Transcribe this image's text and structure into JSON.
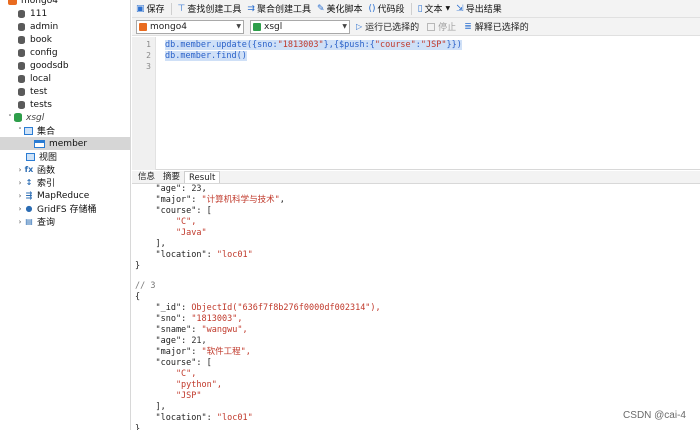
{
  "sidebar": {
    "connection": "mongo4",
    "databases": [
      "111",
      "admin",
      "book",
      "config",
      "goodsdb",
      "local",
      "test",
      "tests"
    ],
    "current_db": "xsgl",
    "collections_group": "集合",
    "collection": "member",
    "nodes": [
      "视图",
      "函数",
      "索引",
      "MapReduce",
      "GridFS 存储桶",
      "查询"
    ]
  },
  "toolbar": {
    "save": "保存",
    "find_builder": "查找创建工具",
    "aggregate_builder": "聚合创建工具",
    "beautify": "美化脚本",
    "snippet": "代码段",
    "text": "文本",
    "export": "导出结果"
  },
  "selectbar": {
    "connection_value": "mongo4",
    "db_value": "xsgl",
    "run_selected": "运行已选择的",
    "stop": "停止",
    "explain_selected": "解释已选择的"
  },
  "editor": {
    "line_numbers": [
      "1",
      "2",
      "3"
    ],
    "line1_pre": "db.member.update({sno:",
    "line1_s1": "\"1813003\"",
    "line1_mid": "},{$push:{",
    "line1_s2": "\"course\"",
    "line1_colon": ":",
    "line1_s3": "\"JSP\"",
    "line1_end": "}})",
    "line2": "db.member.find()"
  },
  "result_tabs": [
    "信息",
    "摘要",
    "Result"
  ],
  "output": {
    "l1_key": "    \"age\"",
    "l1_val": "23",
    "l2_key": "    \"major\"",
    "l2_val": "\"计算机科学与技术\"",
    "l3": "    \"course\": [",
    "l4": "        \"C\",",
    "l5": "        \"Java\"",
    "l6": "    ],",
    "l7_key": "    \"location\"",
    "l7_val": "\"loc01\"",
    "l8": "}",
    "l9": "// 3",
    "l10": "{",
    "l11_key": "    \"_id\"",
    "l11_val": "ObjectId(\"636f7f8b276f0000df002314\"),",
    "l12_key": "    \"sno\"",
    "l12_val": "\"1813003\",",
    "l13_key": "    \"sname\"",
    "l13_val": "\"wangwu\",",
    "l14_key": "    \"age\"",
    "l14_val": "21,",
    "l15_key": "    \"major\"",
    "l15_val": "\"软件工程\",",
    "l16": "    \"course\": [",
    "l17": "        \"C\",",
    "l18": "        \"python\",",
    "l19": "        \"JSP\"",
    "l20": "    ],",
    "l21_key": "    \"location\"",
    "l21_val": "\"loc01\"",
    "l22": "}"
  },
  "watermark": "CSDN @cai-4"
}
